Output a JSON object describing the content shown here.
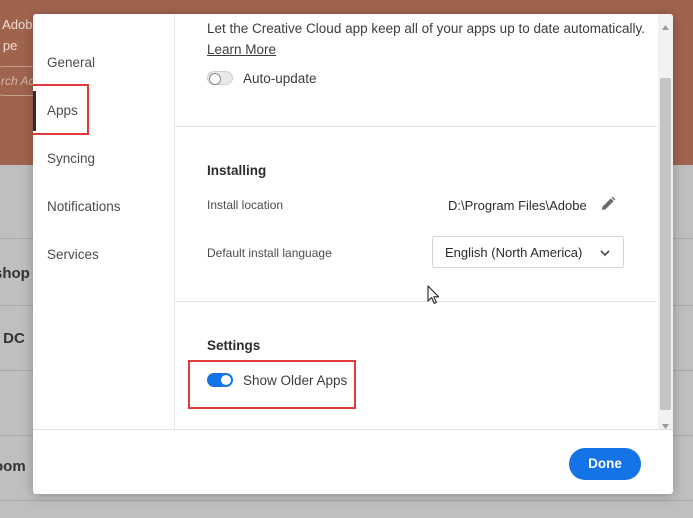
{
  "background_app": {
    "header_lines": [
      "e Adob",
      "e pe"
    ],
    "search_placeholder": "rch Ac",
    "list_rows": [
      "shop",
      "t DC",
      "oom"
    ]
  },
  "sidebar": {
    "items": [
      {
        "label": "General",
        "active": false
      },
      {
        "label": "Apps",
        "active": true
      },
      {
        "label": "Syncing",
        "active": false
      },
      {
        "label": "Notifications",
        "active": false
      },
      {
        "label": "Services",
        "active": false
      }
    ]
  },
  "auto_update": {
    "description": "Let the Creative Cloud app keep all of your apps up to date automatically.",
    "learn_more": "Learn More",
    "toggle_label": "Auto-update",
    "enabled": false
  },
  "installing": {
    "heading": "Installing",
    "location_label": "Install location",
    "location_value": "D:\\Program Files\\Adobe",
    "language_label": "Default install language",
    "language_value": "English (North America)"
  },
  "settings": {
    "heading": "Settings",
    "show_older_label": "Show Older Apps",
    "show_older_enabled": true
  },
  "footer": {
    "done_label": "Done"
  },
  "colors": {
    "accent": "#1473e6",
    "highlight": "#e03a3a",
    "header_bg": "#a0644e"
  }
}
